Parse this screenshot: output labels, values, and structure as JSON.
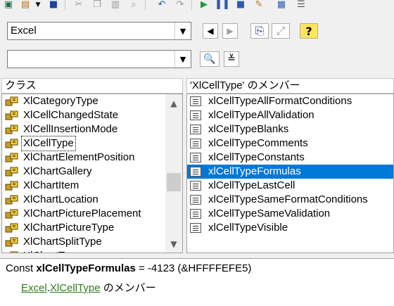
{
  "toolbar": {
    "icons": [
      "excel-icon",
      "view-icon",
      "dropdown-icon",
      "save-icon",
      "cut-icon",
      "copy-icon",
      "paste-icon",
      "find-icon",
      "undo-icon",
      "redo-icon",
      "run-icon",
      "pause-icon",
      "stop-icon",
      "design-icon",
      "project-icon",
      "properties-icon"
    ]
  },
  "library_combo": {
    "value": "Excel"
  },
  "search_combo": {
    "value": ""
  },
  "nav": {
    "back_label": "◀",
    "forward_label": "▶",
    "copy_label": "⎘",
    "view_def_label": "⤢",
    "help_label": "?",
    "search_label": "🔍",
    "toggle_label": "≚"
  },
  "classes": {
    "header": "クラス",
    "items": [
      "XlCategoryType",
      "XlCellChangedState",
      "XlCellInsertionMode",
      "XlCellType",
      "XlChartElementPosition",
      "XlChartGallery",
      "XlChartItem",
      "XlChartLocation",
      "XlChartPicturePlacement",
      "XlChartPictureType",
      "XlChartSplitType",
      "XlChartType"
    ],
    "selected_index": 3
  },
  "members": {
    "header": "'XlCellType' のメンバー",
    "items": [
      "xlCellTypeAllFormatConditions",
      "xlCellTypeAllValidation",
      "xlCellTypeBlanks",
      "xlCellTypeComments",
      "xlCellTypeConstants",
      "xlCellTypeFormulas",
      "xlCellTypeLastCell",
      "xlCellTypeSameFormatConditions",
      "xlCellTypeSameValidation",
      "xlCellTypeVisible"
    ],
    "selected_index": 5
  },
  "details": {
    "prefix": "Const ",
    "name": "xlCellTypeFormulas",
    "suffix": " = -4123 (&HFFFFEFE5)",
    "lib_link": "Excel",
    "dot": ".",
    "class_link": "XlCellType",
    "member_of": " のメンバー"
  },
  "colors": {
    "selection": "#0078d7",
    "link": "#2e7d18"
  }
}
